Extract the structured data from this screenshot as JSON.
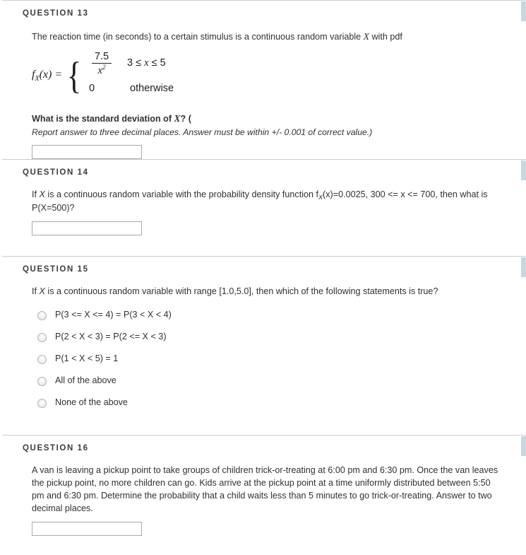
{
  "questions": [
    {
      "header": "QUESTION 13",
      "intro_pre": "The reaction time (in seconds) to a certain stimulus is a continuous random variable ",
      "intro_var": "X",
      "intro_post": " with pdf",
      "formula": {
        "lhs_f": "f",
        "lhs_sub": "X",
        "lhs_arg": "(x) =",
        "case1_num": "7.5",
        "case1_den": "x",
        "case1_den_exp": "2",
        "case1_cond_a": "3 ≤ ",
        "case1_cond_var": "x",
        "case1_cond_b": " ≤ 5",
        "case2_val": "0",
        "case2_cond": "otherwise"
      },
      "prompt_pre": "What is the standard deviation of ",
      "prompt_var": "X",
      "prompt_post": "? (",
      "note": "Report answer to three decimal places. Answer must be within +/- 0.001 of correct value.)",
      "answer_value": "",
      "answer_placeholder": ""
    },
    {
      "header": "QUESTION 14",
      "text_a": "If ",
      "text_var": "X",
      "text_b": " is a continuous random variable with the probability density function f",
      "text_sub": "X",
      "text_c": "(x)=0.0025, 300 <= x <= 700, then what is P(X=500)?",
      "answer_value": "",
      "answer_placeholder": ""
    },
    {
      "header": "QUESTION 15",
      "text_a": "If ",
      "text_var": "X",
      "text_b": " is a continuous random variable with range [1.0,5.0], then which of the following statements is true?",
      "options": [
        "P(3 <= X <= 4) = P(3 < X < 4)",
        "P(2 < X < 3) = P(2 <= X < 3)",
        "P(1 < X < 5) = 1",
        "All of the above",
        "None of the above"
      ],
      "selected": null
    },
    {
      "header": "QUESTION 16",
      "text": "A van is leaving a pickup point to take groups of children trick-or-treating at 6:00 pm and 6:30 pm. Once the van leaves the pickup point, no more children can go.  Kids arrive at the pickup point at a time uniformly distributed between 5:50 pm and 6:30 pm. Determine the probability that a child waits less than 5 minutes to go trick-or-treating. Answer to two decimal places.",
      "answer_value": "",
      "answer_placeholder": ""
    }
  ],
  "theme": {
    "tab_color": "#c7d7df",
    "separator_color": "#cccccc",
    "text_color": "#2d3135",
    "input_border": "#a9a9a9"
  }
}
